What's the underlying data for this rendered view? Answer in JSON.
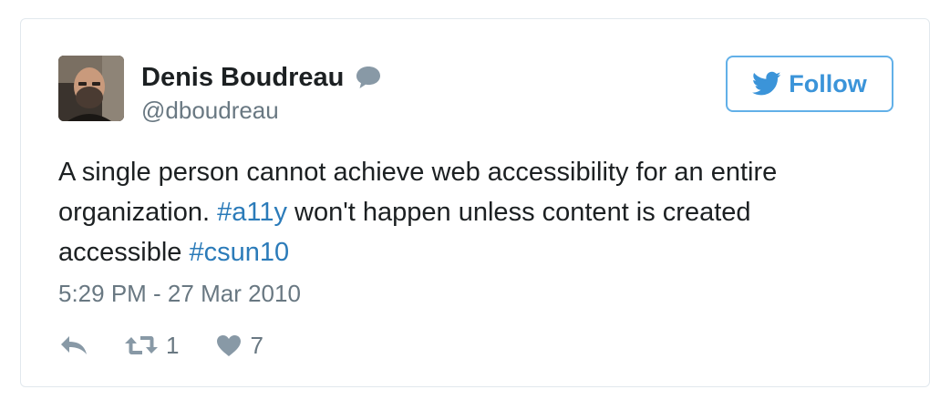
{
  "tweet": {
    "author": {
      "name": "Denis Boudreau",
      "handle": "@dboudreau"
    },
    "follow_label": "Follow",
    "text": {
      "part1": "A single person cannot achieve web accessibility for an entire organization. ",
      "hashtag1": "#a11y",
      "part2": " won't happen unless content is created accessible ",
      "hashtag2": "#csun10"
    },
    "timestamp": "5:29 PM - 27 Mar 2010",
    "actions": {
      "retweet_count": "1",
      "like_count": "7"
    },
    "colors": {
      "accent": "#3b94d9",
      "hashtag": "#2b7bb9",
      "text": "#1c2022",
      "muted": "#697882",
      "border": "#e1e8ed"
    },
    "icons": [
      "chat-icon",
      "twitter-bird-icon",
      "reply-icon",
      "retweet-icon",
      "heart-icon"
    ]
  }
}
